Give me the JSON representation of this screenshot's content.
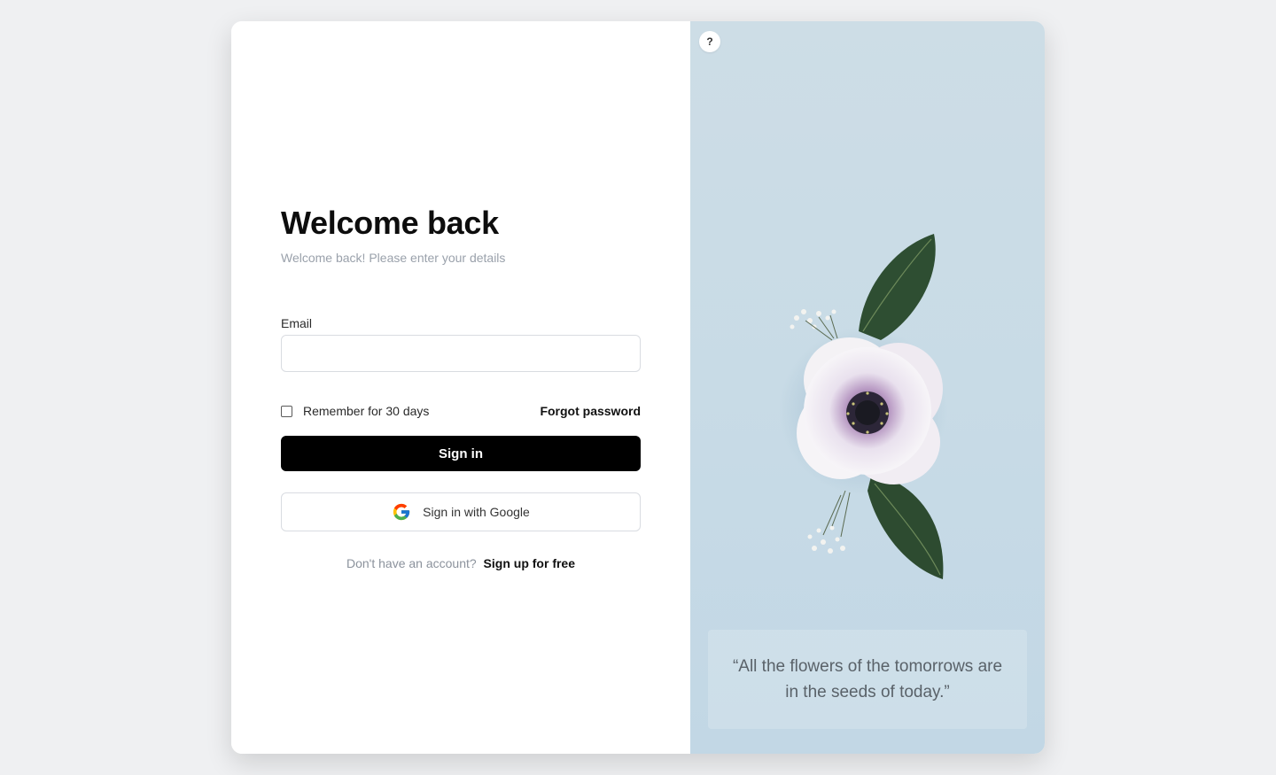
{
  "login": {
    "title": "Welcome back",
    "subtitle": "Welcome back! Please enter your details",
    "email_label": "Email",
    "email_value": "",
    "email_placeholder": "",
    "remember_label": "Remember for 30 days",
    "remember_checked": false,
    "forgot_label": "Forgot password",
    "signin_label": "Sign in",
    "google_label": "Sign in with Google",
    "signup_prompt": "Don't have an account?",
    "signup_link": "Sign up for free"
  },
  "aside": {
    "help_label": "?",
    "quote": "“All the flowers of the tomorrows are in the seeds of today.”"
  },
  "colors": {
    "primary": "#000000",
    "aside_background": "#c8dbe6",
    "page_background": "#eff0f2"
  }
}
